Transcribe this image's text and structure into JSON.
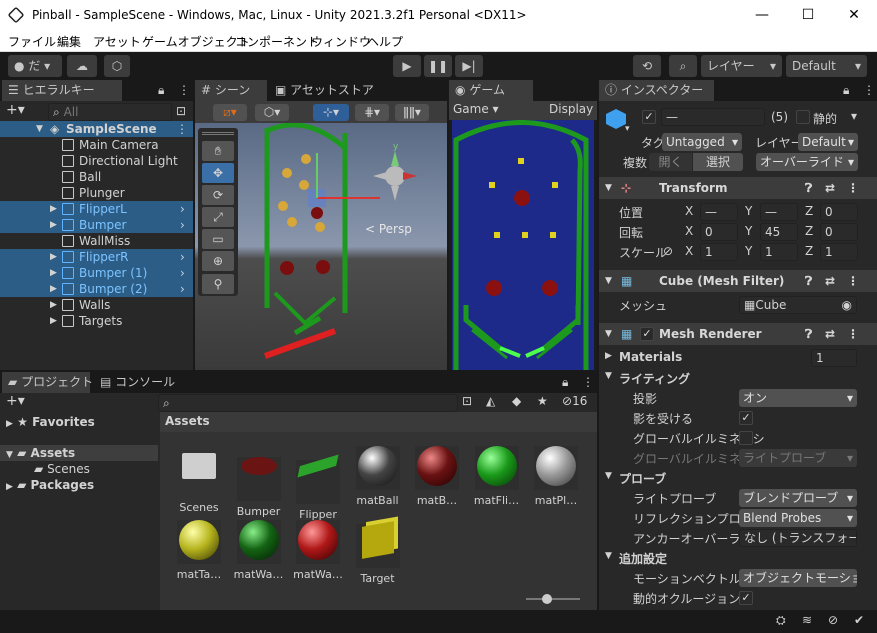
{
  "window": {
    "title": "Pinball - SampleScene - Windows, Mac, Linux - Unity 2021.3.2f1 Personal <DX11>",
    "minimize": "—",
    "maximize": "☐",
    "close": "✕"
  },
  "menu": [
    "ファイル",
    "編集",
    "アセット",
    "ゲームオブジェクト",
    "コンポーネント",
    "ウィンドウ",
    "ヘルプ"
  ],
  "toolbar": {
    "account": "だ",
    "layers": "レイヤー",
    "layout": "Default"
  },
  "hierarchy": {
    "tab": "ヒエラルキー",
    "search_placeholder": "All",
    "scene": "SampleScene",
    "items": [
      "Main Camera",
      "Directional Light",
      "Ball",
      "Plunger",
      "FlipperL",
      "Bumper",
      "WallMiss",
      "FlipperR",
      "Bumper (1)",
      "Bumper (2)",
      "Walls",
      "Targets"
    ]
  },
  "scene_tabs": {
    "scene": "シーン",
    "store": "アセットストア",
    "game": "ゲーム",
    "persp": "< Persp",
    "game_dd": "Game",
    "display": "Display"
  },
  "inspector": {
    "tab": "インスペクター",
    "name": "—",
    "count": "(5)",
    "static": "静的",
    "tag_label": "タグ",
    "tag": "Untagged",
    "layer_label": "レイヤー",
    "layer": "Default",
    "multi_label": "複数",
    "open": "開く",
    "select": "選択",
    "override": "オーバーライド",
    "transform": {
      "title": "Transform",
      "pos_label": "位置",
      "rot_label": "回転",
      "scale_label": "スケール",
      "pos": [
        "—",
        "—",
        "0"
      ],
      "rot": [
        "0",
        "45",
        "0"
      ],
      "scale": [
        "1",
        "1",
        "1"
      ],
      "axes": [
        "X",
        "Y",
        "Z"
      ]
    },
    "meshfilter": {
      "title": "Cube (Mesh Filter)",
      "mesh_label": "メッシュ",
      "mesh": "Cube"
    },
    "meshrenderer": {
      "title": "Mesh Renderer",
      "materials": "Materials",
      "materials_count": "1",
      "lighting": "ライティング",
      "cast_label": "投影",
      "cast": "オン",
      "receive_label": "影を受ける",
      "gi_label": "グローバルイルミネーシ",
      "gi2_label": "グローバルイルミネーシ",
      "gi2": "ライトプローブ",
      "probes": "プローブ",
      "lp_label": "ライトプローブ",
      "lp": "ブレンドプローブ",
      "rp_label": "リフレクションプローブ",
      "rp": "Blend Probes",
      "anchor_label": "アンカーオーバーライド",
      "anchor": "なし (トランスフォーム",
      "extra": "追加設定",
      "motion_label": "モーションベクトル",
      "motion": "オブジェクトモーション",
      "occl_label": "動的オクルージョン"
    }
  },
  "project": {
    "tab": "プロジェクト",
    "console": "コンソール",
    "favorites": "Favorites",
    "assets": "Assets",
    "scenes": "Scenes",
    "packages": "Packages",
    "breadcrumb": "Assets",
    "hidden_count": "16",
    "items": [
      "Scenes",
      "Bumper",
      "Flipper",
      "matBall",
      "matB…",
      "matFli…",
      "matPl…",
      "matTa…",
      "matWa…",
      "matWa…",
      "Target"
    ]
  },
  "colors": {
    "accent": "#3a79bb",
    "green": "#1f9a1f",
    "red": "#8b1010",
    "bluebg": "#1e2a8a"
  }
}
